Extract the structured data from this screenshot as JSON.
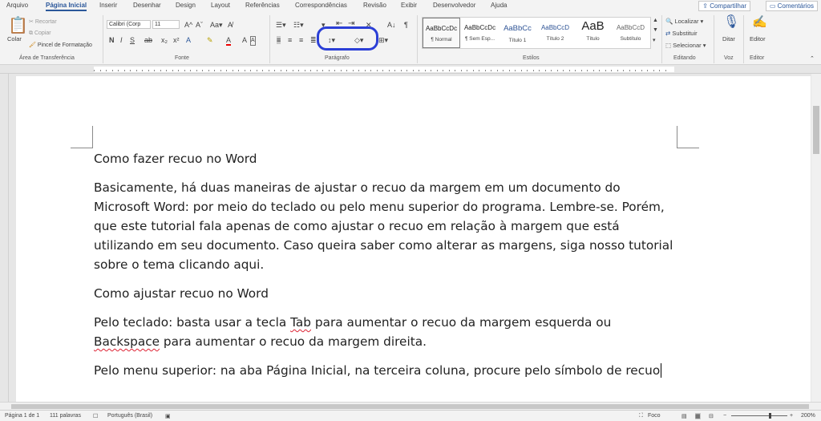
{
  "tabs": [
    "Arquivo",
    "Página Inicial",
    "Inserir",
    "Desenhar",
    "Design",
    "Layout",
    "Referências",
    "Correspondências",
    "Revisão",
    "Exibir",
    "Desenvolvedor",
    "Ajuda"
  ],
  "share_label": "Compartilhar",
  "comments_label": "Comentários",
  "clipboard": {
    "paste": "Colar",
    "cut": "Recortar",
    "copy": "Copiar",
    "painter": "Pincel de Formatação",
    "label": "Área de Transferência"
  },
  "font": {
    "name": "Calibri (Corp",
    "size": "11",
    "label": "Fonte"
  },
  "paragraph": {
    "label": "Parágrafo"
  },
  "styles": {
    "label": "Estilos",
    "items": [
      {
        "preview": "AaBbCcDc",
        "name": "¶ Normal"
      },
      {
        "preview": "AaBbCcDc",
        "name": "¶ Sem Esp..."
      },
      {
        "preview": "AaBbCc",
        "name": "Título 1"
      },
      {
        "preview": "AaBbCcD",
        "name": "Título 2"
      },
      {
        "preview": "AaB",
        "name": "Título"
      },
      {
        "preview": "AaBbCcD",
        "name": "Subtítulo"
      }
    ]
  },
  "editing": {
    "find": "Localizar",
    "replace": "Substituir",
    "select": "Selecionar",
    "label": "Editando"
  },
  "voice": {
    "dictate": "Ditar",
    "label": "Voz"
  },
  "editor": {
    "button": "Editor",
    "label": "Editor"
  },
  "document": {
    "title1": "Como fazer recuo no Word",
    "para1": "Basicamente, há duas maneiras de ajustar o recuo da margem em um documento do Microsoft Word: por meio do teclado ou pelo menu superior do programa. Lembre-se. Porém, que este tutorial fala apenas de como ajustar o recuo em relação à margem que está utilizando em seu documento. Caso queira saber como alterar as margens, siga nosso tutorial sobre o tema clicando aqui.",
    "title2": "Como ajustar recuo no Word",
    "para2_a": "Pelo teclado: basta usar a tecla ",
    "para2_tab": "Tab",
    "para2_b": " para aumentar o recuo da margem esquerda ou ",
    "para2_backspace": "Backspace",
    "para2_c": " para aumentar o recuo da margem direita.",
    "para3": "Pelo menu superior: na aba Página Inicial, na terceira coluna, procure pelo símbolo de recuo"
  },
  "status": {
    "page": "Página 1 de 1",
    "words": "111 palavras",
    "language": "Português (Brasil)",
    "focus": "Foco",
    "zoom": "200%"
  }
}
